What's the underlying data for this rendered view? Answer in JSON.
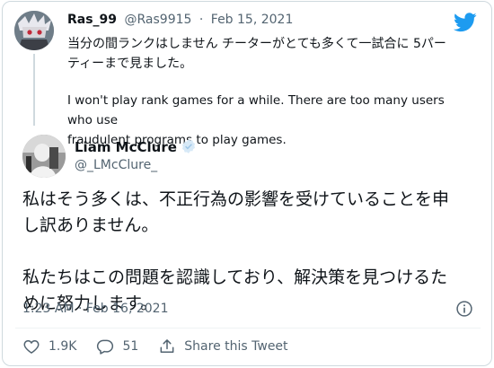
{
  "quoted": {
    "name": "Ras_99",
    "handle": "@Ras9915",
    "date": "Feb 15, 2021",
    "text_jp_line1": "当分の間ランクはしません チーターがとても多くて一試合に 5パー",
    "text_jp_line2": "ティーまで見ました。",
    "text_en_line1": "I won't play rank games for a while. There are too many users who use",
    "text_en_line2": "fraudulent programs to play games."
  },
  "tweet": {
    "name": "Liam McClure",
    "handle": "@_LMcClure_",
    "para1_line1": "私はそう多くは、不正行為の影響を受けていることを申",
    "para1_line2": "し訳ありません。",
    "para2_line1": "私たちはこの問題を認識しており、解決策を見つけるた",
    "para2_line2": "めに努力します。",
    "timestamp": "1:23 AM · Feb 16, 2021"
  },
  "actions": {
    "likes": "1.9K",
    "replies": "51",
    "share_label": "Share this Tweet"
  },
  "colors": {
    "brand": "#1d9bf0",
    "text": "#0f1419",
    "muted": "#536471",
    "border": "#cfd9de"
  },
  "icons": [
    "twitter-bird-icon",
    "verified-badge-icon",
    "info-icon",
    "heart-icon",
    "reply-icon",
    "share-icon"
  ]
}
